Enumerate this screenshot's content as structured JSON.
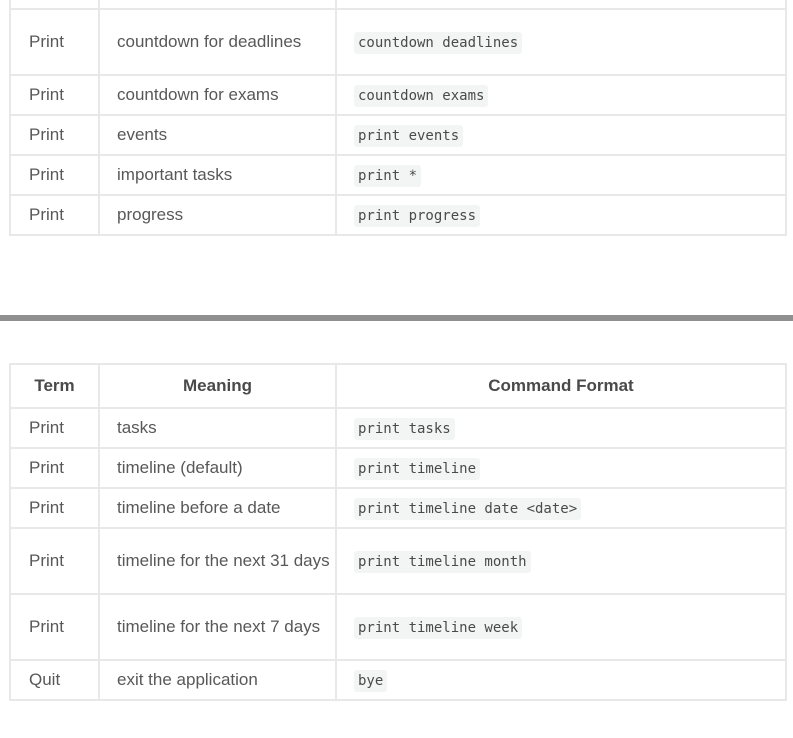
{
  "top_table": {
    "rows": [
      {
        "term": "",
        "meaning": "",
        "command": ""
      },
      {
        "term": "Print",
        "meaning": "countdown for deadlines",
        "command": "countdown deadlines"
      },
      {
        "term": "Print",
        "meaning": "countdown for exams",
        "command": "countdown exams"
      },
      {
        "term": "Print",
        "meaning": "events",
        "command": "print events"
      },
      {
        "term": "Print",
        "meaning": "important tasks",
        "command": "print *"
      },
      {
        "term": "Print",
        "meaning": "progress",
        "command": "print progress"
      }
    ]
  },
  "bottom_table": {
    "headers": {
      "term": "Term",
      "meaning": "Meaning",
      "command": "Command Format"
    },
    "rows": [
      {
        "term": "Print",
        "meaning": "tasks",
        "command": "print tasks"
      },
      {
        "term": "Print",
        "meaning": "timeline (default)",
        "command": "print timeline"
      },
      {
        "term": "Print",
        "meaning": "timeline before a date",
        "command": "print timeline date <date>"
      },
      {
        "term": "Print",
        "meaning": "timeline for the next 31 days",
        "command": "print timeline month"
      },
      {
        "term": "Print",
        "meaning": "timeline for the next 7 days",
        "command": "print timeline week"
      },
      {
        "term": "Quit",
        "meaning": "exit the application",
        "command": "bye"
      }
    ]
  }
}
